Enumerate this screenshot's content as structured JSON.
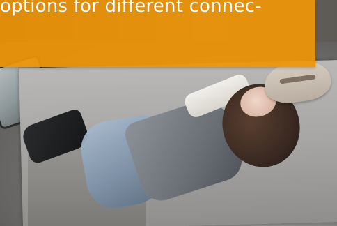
{
  "banner": {
    "text": "options for different connec-"
  },
  "colors": {
    "banner_bg": "#EE9608",
    "banner_text": "#FFFFFF"
  }
}
